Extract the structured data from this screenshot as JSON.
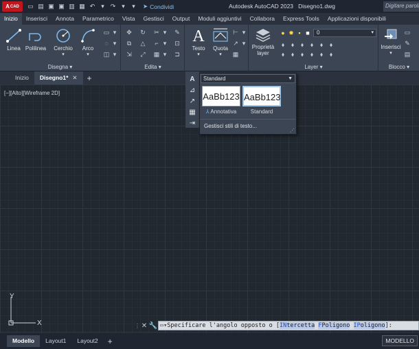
{
  "titlebar": {
    "logo_text": "CAD",
    "share_label": "Condividi",
    "app_title": "Autodesk AutoCAD 2023",
    "file_name": "Disegno1.dwg",
    "search_placeholder": "Digitare parola"
  },
  "ribbon_tabs": [
    "Inizio",
    "Inserisci",
    "Annota",
    "Parametrico",
    "Vista",
    "Gestisci",
    "Output",
    "Moduli aggiuntivi",
    "Collabora",
    "Express Tools",
    "Applicazioni disponibili"
  ],
  "ribbon": {
    "draw": {
      "title": "Disegna",
      "linea": "Linea",
      "polilinea": "Polilinea",
      "cerchio": "Cerchio",
      "arco": "Arco"
    },
    "modify": {
      "title": "Edita"
    },
    "annotation": {
      "testo": "Testo",
      "quota": "Quota"
    },
    "layers": {
      "title": "Layer",
      "proprieta": "Proprietà",
      "layer_word": "layer",
      "current_layer": "0"
    },
    "block": {
      "title": "Blocco",
      "inserisci": "Inserisci"
    }
  },
  "file_tabs": {
    "start": "Inizio",
    "current": "Disegno1*"
  },
  "viewport_label": "[−][Alto][Wireframe 2D]",
  "text_style_dropdown": {
    "current": "Standard",
    "styles": [
      {
        "preview": "AaBb123",
        "name": "Annotativa"
      },
      {
        "preview": "AaBb123",
        "name": "Standard"
      }
    ],
    "manage": "Gestisci stili di testo..."
  },
  "ucs": {
    "x_label": "X",
    "y_label": "Y"
  },
  "command_line": {
    "prompt": "Specificare l'angolo opposto o [",
    "option1_key": "IN",
    "option1_rest": "tercetta",
    "option2_key": "F",
    "option2_rest": "Poligono",
    "option3_key": "IP",
    "option3_rest": "oligono",
    "suffix": "]:"
  },
  "layout_tabs": [
    "Modello",
    "Layout1",
    "Layout2"
  ],
  "status": {
    "model_button": "MODELLO"
  }
}
